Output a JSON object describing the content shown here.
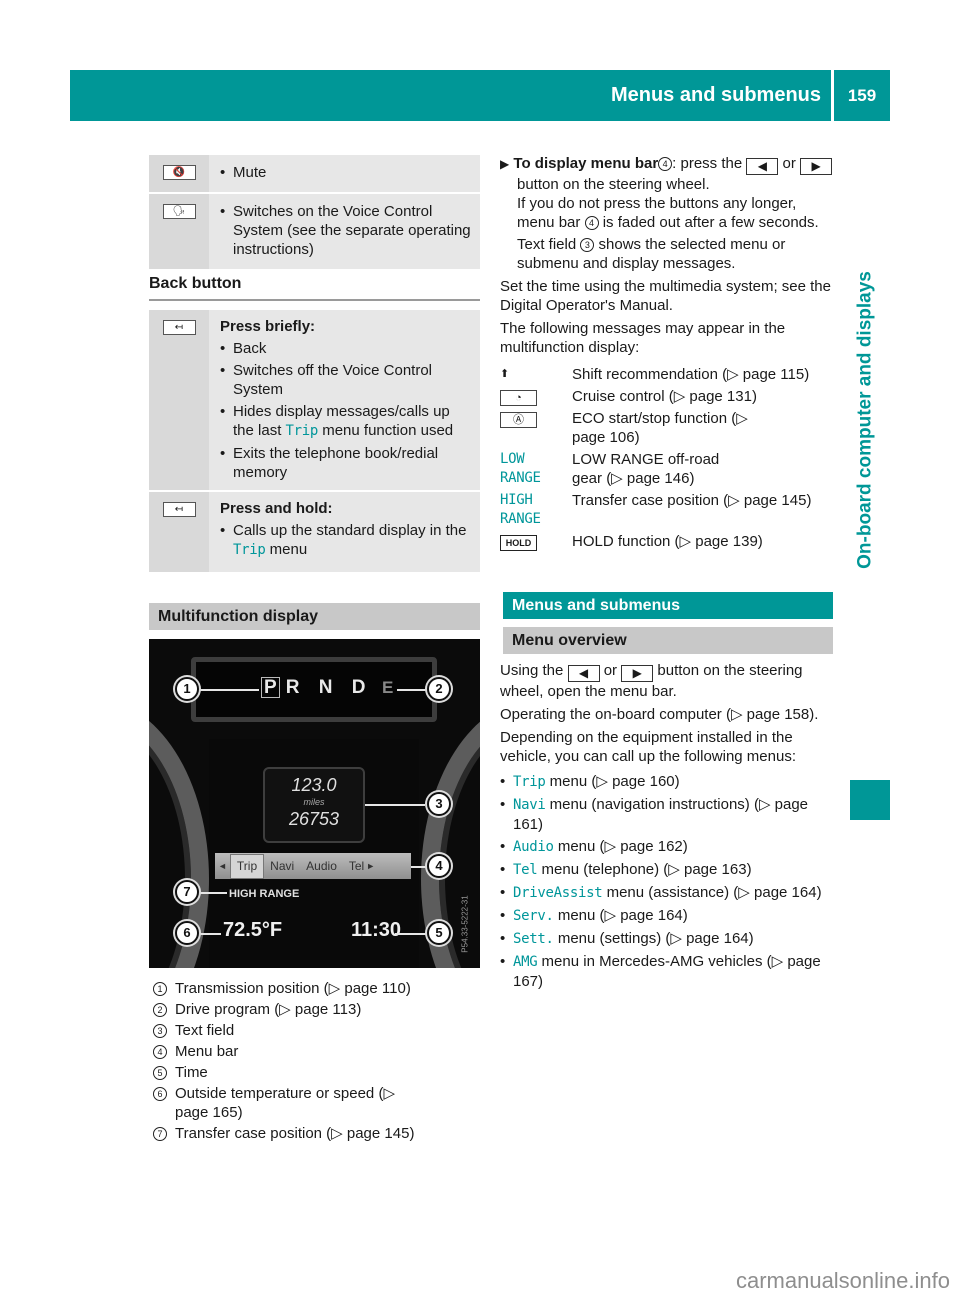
{
  "header": {
    "section_title": "Menus and submenus",
    "page_number": "159",
    "chapter": "On-board computer and displays"
  },
  "colors": {
    "accent": "#009797",
    "grey_bar": "#c8c8c8",
    "table_bg": "#e7e7e7"
  },
  "top_table": [
    {
      "icon": "mute-icon",
      "icon_glyph": "🔇",
      "bullets": [
        "Mute"
      ]
    },
    {
      "icon": "voice-control-icon",
      "icon_glyph": "🗣",
      "bullets": [
        "Switches on the Voice Control System (see the separate operating instructions)"
      ]
    }
  ],
  "back_button": {
    "title": "Back button",
    "rows": [
      {
        "icon": "back-icon",
        "icon_glyph": "↤",
        "heading": "Press briefly:",
        "bullets": [
          {
            "text": "Back"
          },
          {
            "text": "Switches off the Voice Control System"
          },
          {
            "pre": "Hides display messages/calls up the last ",
            "code": "Trip",
            "post": " menu function used"
          },
          {
            "text": "Exits the telephone book/redial memory"
          }
        ]
      },
      {
        "icon": "back-icon",
        "icon_glyph": "↤",
        "heading": "Press and hold:",
        "bullets": [
          {
            "pre": "Calls up the standard display in the ",
            "code": "Trip",
            "post": " menu"
          }
        ]
      }
    ]
  },
  "multifunction_display": {
    "title": "Multifunction display",
    "photo": {
      "gears": "R N D",
      "gear_selected": "P",
      "drive_program": "E",
      "text_field_value": "123.0",
      "text_field_unit": "miles",
      "odometer": "26753",
      "menu_bar": [
        "Trip",
        "Navi",
        "Audio",
        "Tel"
      ],
      "menu_prev": "◄",
      "menu_next": "►",
      "transfer_case": "HIGH RANGE",
      "temperature": "72.5°F",
      "time": "11:30",
      "image_code": "P54.33-5222-31",
      "callouts": [
        "1",
        "2",
        "3",
        "4",
        "5",
        "6",
        "7"
      ]
    },
    "legend": [
      {
        "num": "1",
        "text": "Transmission position (▷ page 110)"
      },
      {
        "num": "2",
        "text": "Drive program (▷ page 113)"
      },
      {
        "num": "3",
        "text": "Text field"
      },
      {
        "num": "4",
        "text": "Menu bar"
      },
      {
        "num": "5",
        "text": "Time"
      },
      {
        "num": "6",
        "text": "Outside temperature or speed (▷ page 165)"
      },
      {
        "num": "7",
        "text": "Transfer case position (▷ page 145)"
      }
    ]
  },
  "right": {
    "instruction": {
      "marker": "▶",
      "bold": "To display menu bar",
      "ref": "4",
      "t1": ": press the",
      "t2": "or",
      "t3": "button on the steering wheel.",
      "btn_left": "◀",
      "btn_right": "▶",
      "p2a": "If you do not press the buttons any longer, menu bar ",
      "p2ref": "4",
      "p2b": " is faded out after a few seconds.",
      "p3a": "Text field ",
      "p3ref": "3",
      "p3b": " shows the selected menu or submenu and display messages."
    },
    "p_time": "Set the time using the multimedia system; see the Digital Operator's Manual.",
    "p_messages": "The following messages may appear in the multifunction display:",
    "messages": [
      {
        "key_type": "arrow",
        "key": "⬆",
        "text": "Shift recommendation (▷ page 115)"
      },
      {
        "key_type": "icon",
        "key": "◔",
        "text": "Cruise control (▷ page 131)"
      },
      {
        "key_type": "icon",
        "key": "Ⓐ",
        "text": "ECO start/stop function (▷ page 106)"
      },
      {
        "key_type": "code",
        "key": "LOW RANGE",
        "text": "LOW RANGE off-road gear (▷ page 146)"
      },
      {
        "key_type": "code",
        "key": "HIGH RANGE",
        "text": "Transfer case position (▷ page 145)"
      },
      {
        "key_type": "hold",
        "key": "HOLD",
        "text": "HOLD function (▷ page 139)"
      }
    ],
    "menus_title": "Menus and submenus",
    "overview_title": "Menu overview",
    "overview_p1a": "Using the",
    "overview_p1b": "or",
    "overview_p1c": "button on the steering wheel, open the menu bar.",
    "overview_p2": "Operating the on-board computer (▷ page 158).",
    "overview_p3": "Depending on the equipment installed in the vehicle, you can call up the following menus:",
    "menus": [
      {
        "code": "Trip",
        "text": " menu (▷ page 160)"
      },
      {
        "code": "Navi",
        "text": " menu (navigation instructions) (▷ page 161)"
      },
      {
        "code": "Audio",
        "text": " menu (▷ page 162)"
      },
      {
        "code": "Tel",
        "text": " menu (telephone) (▷ page 163)"
      },
      {
        "code": "DriveAssist",
        "text": " menu (assistance) (▷ page 164)"
      },
      {
        "code": "Serv.",
        "text": " menu (▷ page 164)"
      },
      {
        "code": "Sett.",
        "text": " menu (settings) (▷ page 164)"
      },
      {
        "code": "AMG",
        "text": " menu in Mercedes-AMG vehicles (▷ page 167)"
      }
    ]
  },
  "footer": {
    "watermark": "carmanualsonline.info"
  }
}
